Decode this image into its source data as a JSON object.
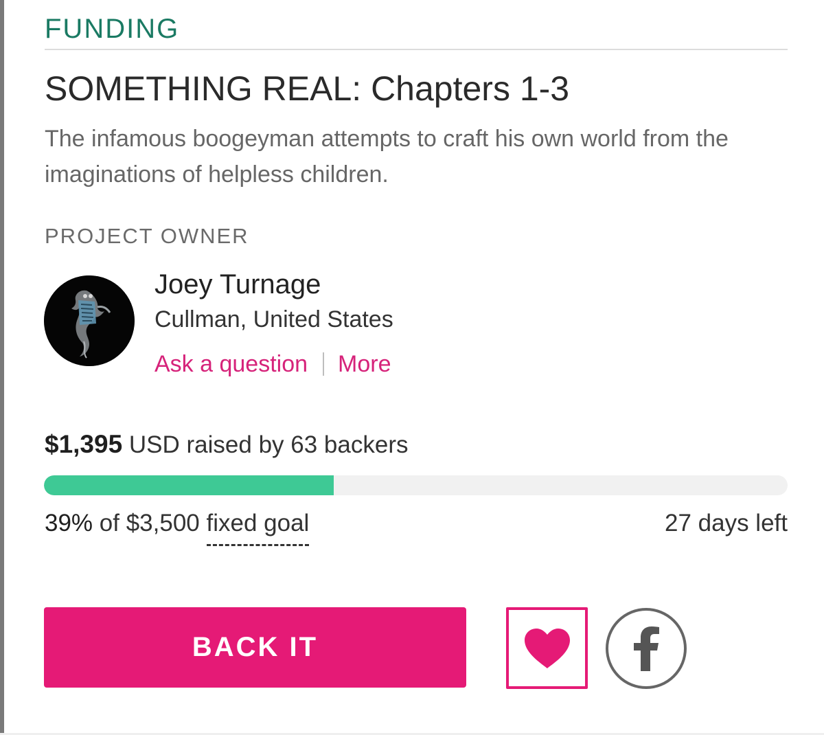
{
  "campaign": {
    "status": "FUNDING",
    "title": "SOMETHING REAL: Chapters 1-3",
    "blurb": "The infamous boogeyman attempts to craft his own world from the imaginations of helpless children."
  },
  "owner": {
    "section_label": "PROJECT OWNER",
    "avatar_icon": "shadowy-creature-avatar",
    "name": "Joey Turnage",
    "location": "Cullman, United States",
    "ask_link": "Ask a question",
    "more_link": "More"
  },
  "funding": {
    "amount": "$1,395",
    "raised_text": "USD raised by 63 backers",
    "percent": "39%",
    "goal_text": "of $3,500",
    "goal_type": "fixed goal",
    "progress_fraction": 0.39,
    "days_left": "27 days left",
    "progress_color": "#3ec995"
  },
  "actions": {
    "back_label": "BACK IT",
    "follow_icon": "heart-icon",
    "share_icon": "facebook-icon",
    "accent_color": "#e51a76"
  }
}
